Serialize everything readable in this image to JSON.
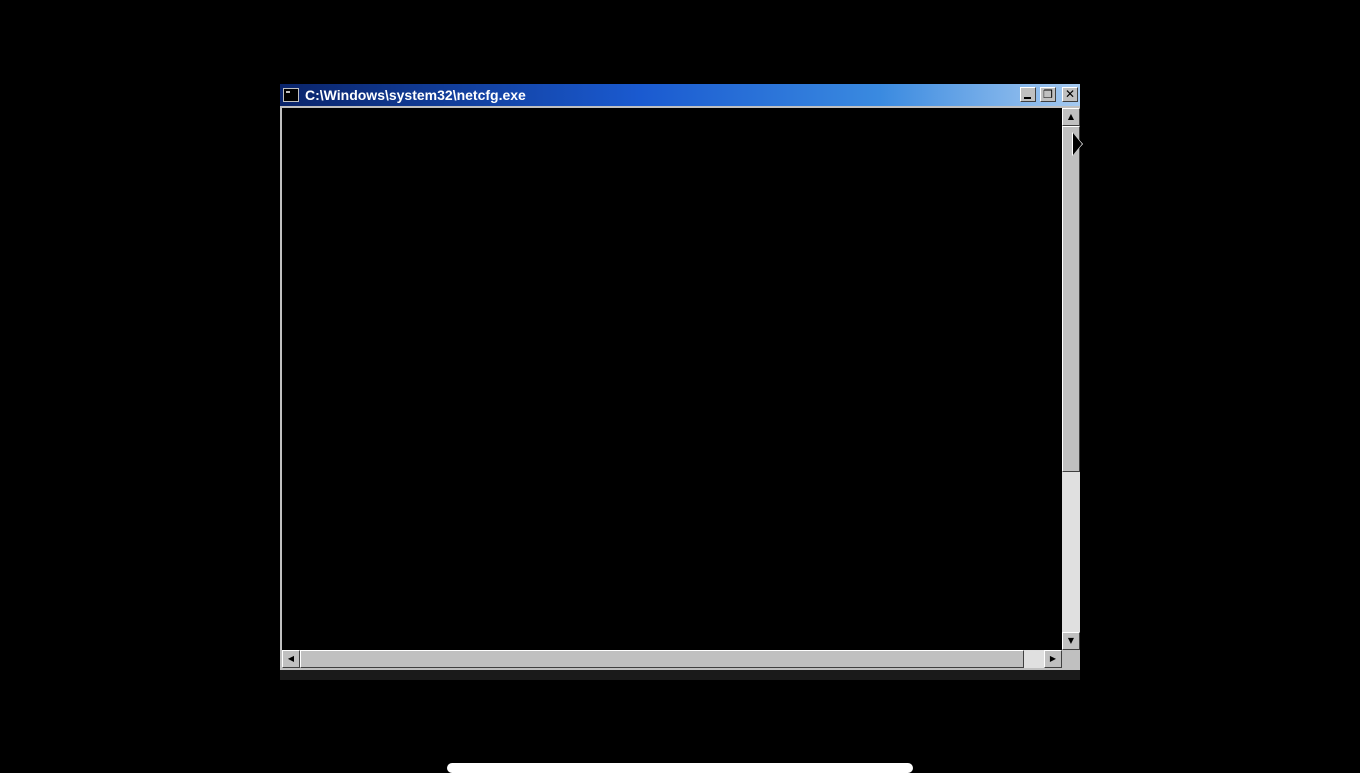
{
  "window": {
    "title": "C:\\Windows\\system32\\netcfg.exe",
    "colors": {
      "titlebar_start": "#0a246a",
      "titlebar_end": "#a6caf0",
      "console_background": "#000000",
      "chrome": "#c0c0c0"
    },
    "buttons": {
      "minimize_icon": "minimize-icon",
      "restore_icon": "restore-icon",
      "close_icon": "close-icon",
      "restore_glyph": "❐",
      "close_glyph": "✕"
    },
    "console_text": ""
  },
  "scrollbars": {
    "vertical": {
      "up_icon": "arrow-up-icon",
      "down_icon": "arrow-down-icon",
      "up_glyph": "▲",
      "down_glyph": "▼"
    },
    "horizontal": {
      "left_icon": "arrow-left-icon",
      "right_icon": "arrow-right-icon",
      "left_glyph": "◀",
      "right_glyph": "▶"
    }
  }
}
